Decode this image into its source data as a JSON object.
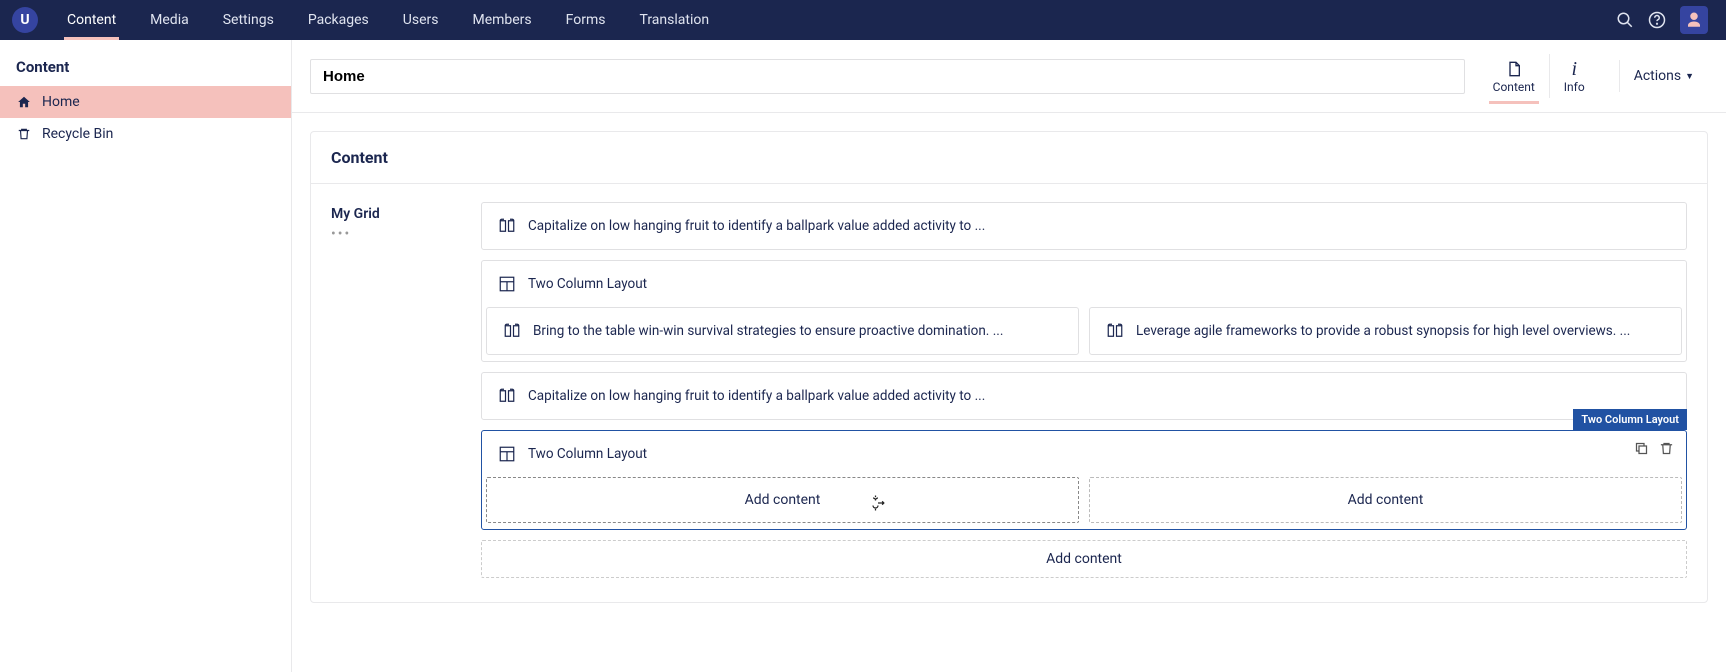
{
  "topnav": {
    "tabs": [
      "Content",
      "Media",
      "Settings",
      "Packages",
      "Users",
      "Members",
      "Forms",
      "Translation"
    ],
    "active_index": 0
  },
  "sidebar": {
    "header": "Content",
    "items": [
      {
        "label": "Home",
        "icon": "home",
        "active": true
      },
      {
        "label": "Recycle Bin",
        "icon": "trash",
        "active": false
      }
    ]
  },
  "editor": {
    "name_value": "Home",
    "app_tabs": [
      {
        "label": "Content",
        "icon": "document",
        "active": true
      },
      {
        "label": "Info",
        "icon": "info",
        "active": false
      }
    ],
    "actions_label": "Actions"
  },
  "panel": {
    "title": "Content",
    "property_label": "My Grid"
  },
  "grid": {
    "blocks": [
      {
        "type": "richtext",
        "text": "Capitalize on low hanging fruit to identify a ballpark value added activity to ..."
      },
      {
        "type": "twocol_populated",
        "header": "Two Column Layout",
        "left": "Bring to the table win-win survival strategies to ensure proactive domination. ...",
        "right": "Leverage agile frameworks to provide a robust synopsis for high level overviews. ..."
      },
      {
        "type": "richtext",
        "text": "Capitalize on low hanging fruit to identify a ballpark value added activity to ..."
      },
      {
        "type": "twocol_empty",
        "header": "Two Column Layout",
        "selected": true,
        "badge": "Two Column Layout",
        "add_label": "Add content"
      }
    ],
    "add_full_label": "Add content"
  }
}
